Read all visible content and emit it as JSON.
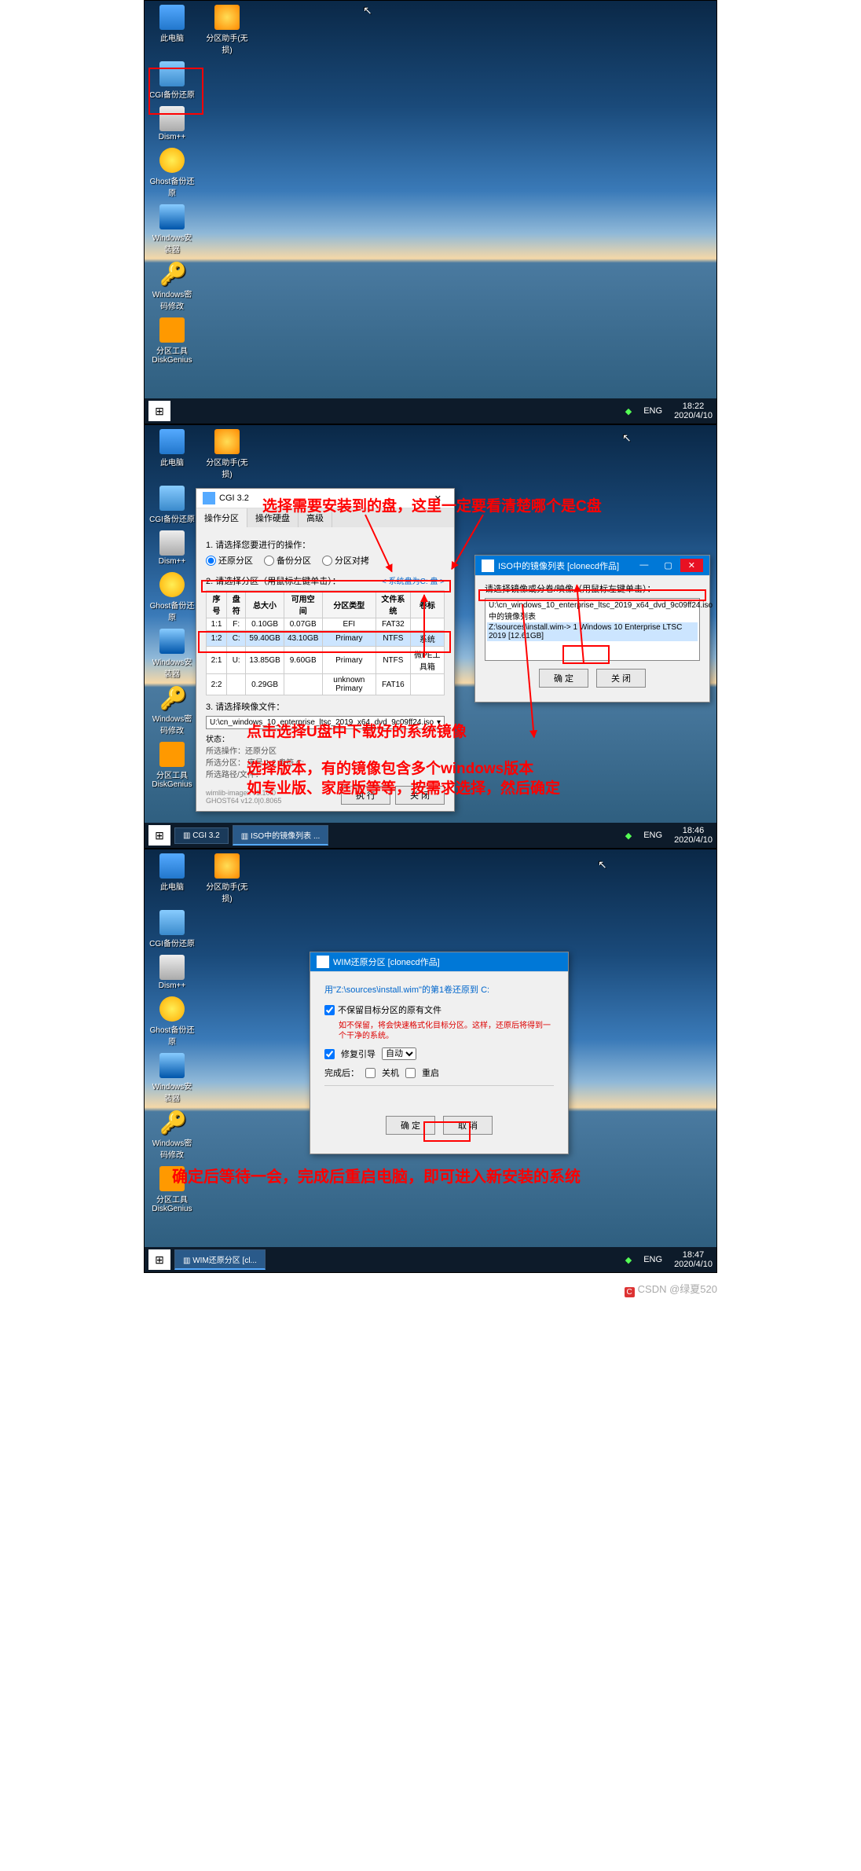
{
  "watermark": {
    "site": "CSDN",
    "user": "@绿夏520"
  },
  "icons": {
    "pc": "此电脑",
    "disk": "分区助手(无损)",
    "cgi": "CGI备份还原",
    "dism": "Dism++",
    "ghost": "Ghost备份还原",
    "win": "Windows安装器",
    "key": "Windows密码修改",
    "dg": "分区工具DiskGenius"
  },
  "tray": {
    "lang": "ENG"
  },
  "s1": {
    "time": "18:22",
    "date": "2020/4/10"
  },
  "s2": {
    "time": "18:46",
    "date": "2020/4/10",
    "cgi_title": "CGI 3.2",
    "tabs": {
      "a": "操作分区",
      "b": "操作硬盘",
      "c": "高级"
    },
    "label1": "1. 请选择您要进行的操作：",
    "radios": {
      "a": "还原分区",
      "b": "备份分区",
      "c": "分区对拷"
    },
    "label2": "2. 请选择分区（用鼠标左键单击）：",
    "sysdisk": "< 系统盘为C: 盘 >",
    "th": {
      "idx": "序号",
      "drv": "盘符",
      "total": "总大小",
      "free": "可用空间",
      "ptype": "分区类型",
      "fs": "文件系统",
      "vol": "卷标"
    },
    "rows": [
      {
        "idx": "1:1",
        "drv": "F:",
        "total": "0.10GB",
        "free": "0.07GB",
        "ptype": "EFI",
        "fs": "FAT32",
        "vol": ""
      },
      {
        "idx": "1:2",
        "drv": "C:",
        "total": "59.40GB",
        "free": "43.10GB",
        "ptype": "Primary",
        "fs": "NTFS",
        "vol": "系统"
      },
      {
        "idx": "2:1",
        "drv": "U:",
        "total": "13.85GB",
        "free": "9.60GB",
        "ptype": "Primary",
        "fs": "NTFS",
        "vol": "微PE工具箱"
      },
      {
        "idx": "2:2",
        "drv": "",
        "total": "0.29GB",
        "free": "",
        "ptype": "unknown Primary",
        "fs": "FAT16",
        "vol": ""
      }
    ],
    "label3": "3. 请选择映像文件：",
    "img_path": "U:\\cn_windows_10_enterprise_ltsc_2019_x64_dvd_9c09ff24.iso",
    "status_t": "状态：",
    "status": {
      "op": "所选操作：还原分区",
      "part": "所选分区： 序号 1:2        盘符 C:",
      "path": "所选路径/文件："
    },
    "ver": {
      "wimlib": "wimlib-imagex v1.10.0",
      "ghost": "GHOST64 v12.0|0.8065"
    },
    "btn": {
      "exec": "执 行",
      "close": "关 闭"
    },
    "iso_dlg": {
      "title": "ISO中的镜像列表   [clonecd作品]",
      "label": "请选择镜像或分卷/映像（用鼠标左键单击）：",
      "line1": "U:\\cn_windows_10_enterprise_ltsc_2019_x64_dvd_9c09ff24.iso中的镜像列表",
      "line2": "Z:\\sources\\install.wim-> 1   Windows 10 Enterprise LTSC 2019 [12.61GB]",
      "ok": "确 定",
      "close": "关 闭"
    },
    "anno": {
      "t1": "选择需要安装到的盘，这里一定要看清楚哪个是C盘",
      "t2": "点击选择U盘中下载好的系统镜像",
      "t3": "选择版本，有的镜像包含多个windows版本",
      "t4": "如专业版、家庭版等等，按需求选择，然后确定"
    },
    "task": {
      "cgi": "CGI 3.2",
      "iso": "ISO中的镜像列表 ..."
    }
  },
  "s3": {
    "time": "18:47",
    "date": "2020/4/10",
    "title": "WIM还原分区   [clonecd作品]",
    "msg": "用\"Z:\\sources\\install.wim\"的第1卷还原到 C:",
    "chk1": "不保留目标分区的原有文件",
    "hint1": "如不保留，将会快速格式化目标分区。这样，还原后将得到一个干净的系统。",
    "chk2": "修复引导",
    "auto": "自动",
    "done": "完成后：",
    "opt_shutdown": "关机",
    "opt_reboot": "重启",
    "ok": "确 定",
    "cancel": "取 消",
    "task": "WIM还原分区   [cl...",
    "anno": "确定后等待一会，完成后重启电脑，即可进入新安装的系统"
  }
}
